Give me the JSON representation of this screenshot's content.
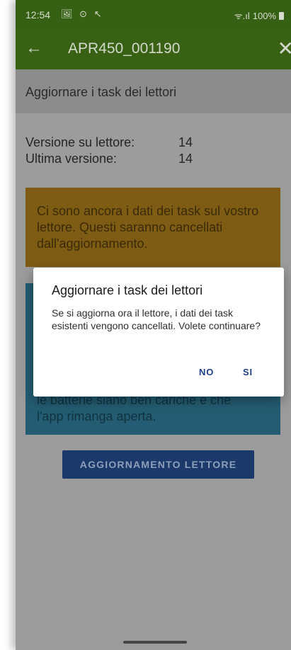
{
  "status_bar": {
    "time": "12:54",
    "left_icons": "🖼 ⊙ ↖",
    "signal": "ᯤ.ıl",
    "battery": "100%"
  },
  "app_bar": {
    "title": "APR450_001190",
    "back_glyph": "←",
    "close_glyph": "✕"
  },
  "section": {
    "title": "Aggiornare i task dei lettori"
  },
  "versions": {
    "reader_label": "Versione su lettore:",
    "reader_value": "14",
    "latest_label": "Ultima versione:",
    "latest_value": "14"
  },
  "warning": {
    "text": "Ci sono ancora i dati dei task sul vostro lettore. Questi saranno cancellati dall'aggiornamento.",
    "color": "#7e5c13"
  },
  "info": {
    "partial_text_line1": "le batterie siano ben cariche e che",
    "partial_text_line2": "l'app rimanga aperta.",
    "color": "#245d73"
  },
  "primary_action": {
    "label": "AGGIORNAMENTO LETTORE"
  },
  "dialog": {
    "title": "Aggiornare i task dei lettori",
    "message": "Se si aggiorna ora il lettore, i dati dei task esistenti vengono cancellati. Volete continuare?",
    "no_label": "NO",
    "yes_label": "SI"
  },
  "colors": {
    "app_bar": "#386114",
    "accent_button": "#1b3a6b",
    "dialog_button_text": "#1f3f86"
  }
}
